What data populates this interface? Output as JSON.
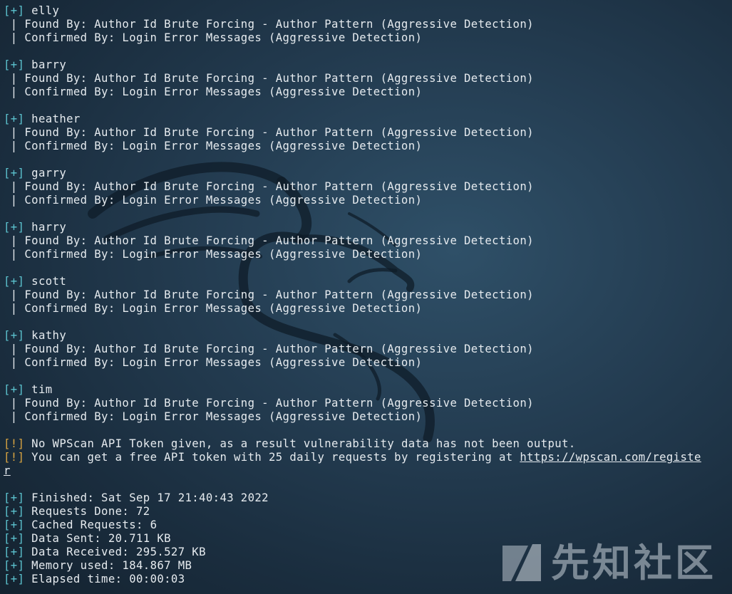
{
  "users": [
    {
      "name": "elly"
    },
    {
      "name": "barry"
    },
    {
      "name": "heather"
    },
    {
      "name": "garry"
    },
    {
      "name": "harry"
    },
    {
      "name": "scott"
    },
    {
      "name": "kathy"
    },
    {
      "name": "tim"
    }
  ],
  "labels": {
    "plus_tag": "[+]",
    "warn_tag": "[!]",
    "found_by": " | Found By: Author Id Brute Forcing - Author Pattern (Aggressive Detection)",
    "confirmed_by": " | Confirmed By: Login Error Messages (Aggressive Detection)"
  },
  "warnings": {
    "no_token": " No WPScan API Token given, as a result vulnerability data has not been output.",
    "free_token_prefix": " You can get a free API token with 25 daily requests by registering at ",
    "url_part1": "https://wpscan.com/registe",
    "url_part2": "r"
  },
  "summary": {
    "finished": " Finished: Sat Sep 17 21:40:43 2022",
    "requests_done": " Requests Done: 72",
    "cached_requests": " Cached Requests: 6",
    "data_sent": " Data Sent: 20.711 KB",
    "data_received": " Data Received: 295.527 KB",
    "memory_used": " Memory used: 184.867 MB",
    "elapsed_time": " Elapsed time: 00:00:03"
  },
  "watermark": {
    "text": "先知社区",
    "icon": "xianzhi-logo-icon"
  },
  "colors": {
    "plus_tag": "#5cc3cf",
    "warn_tag": "#d9a441",
    "text": "#e6ebef"
  }
}
